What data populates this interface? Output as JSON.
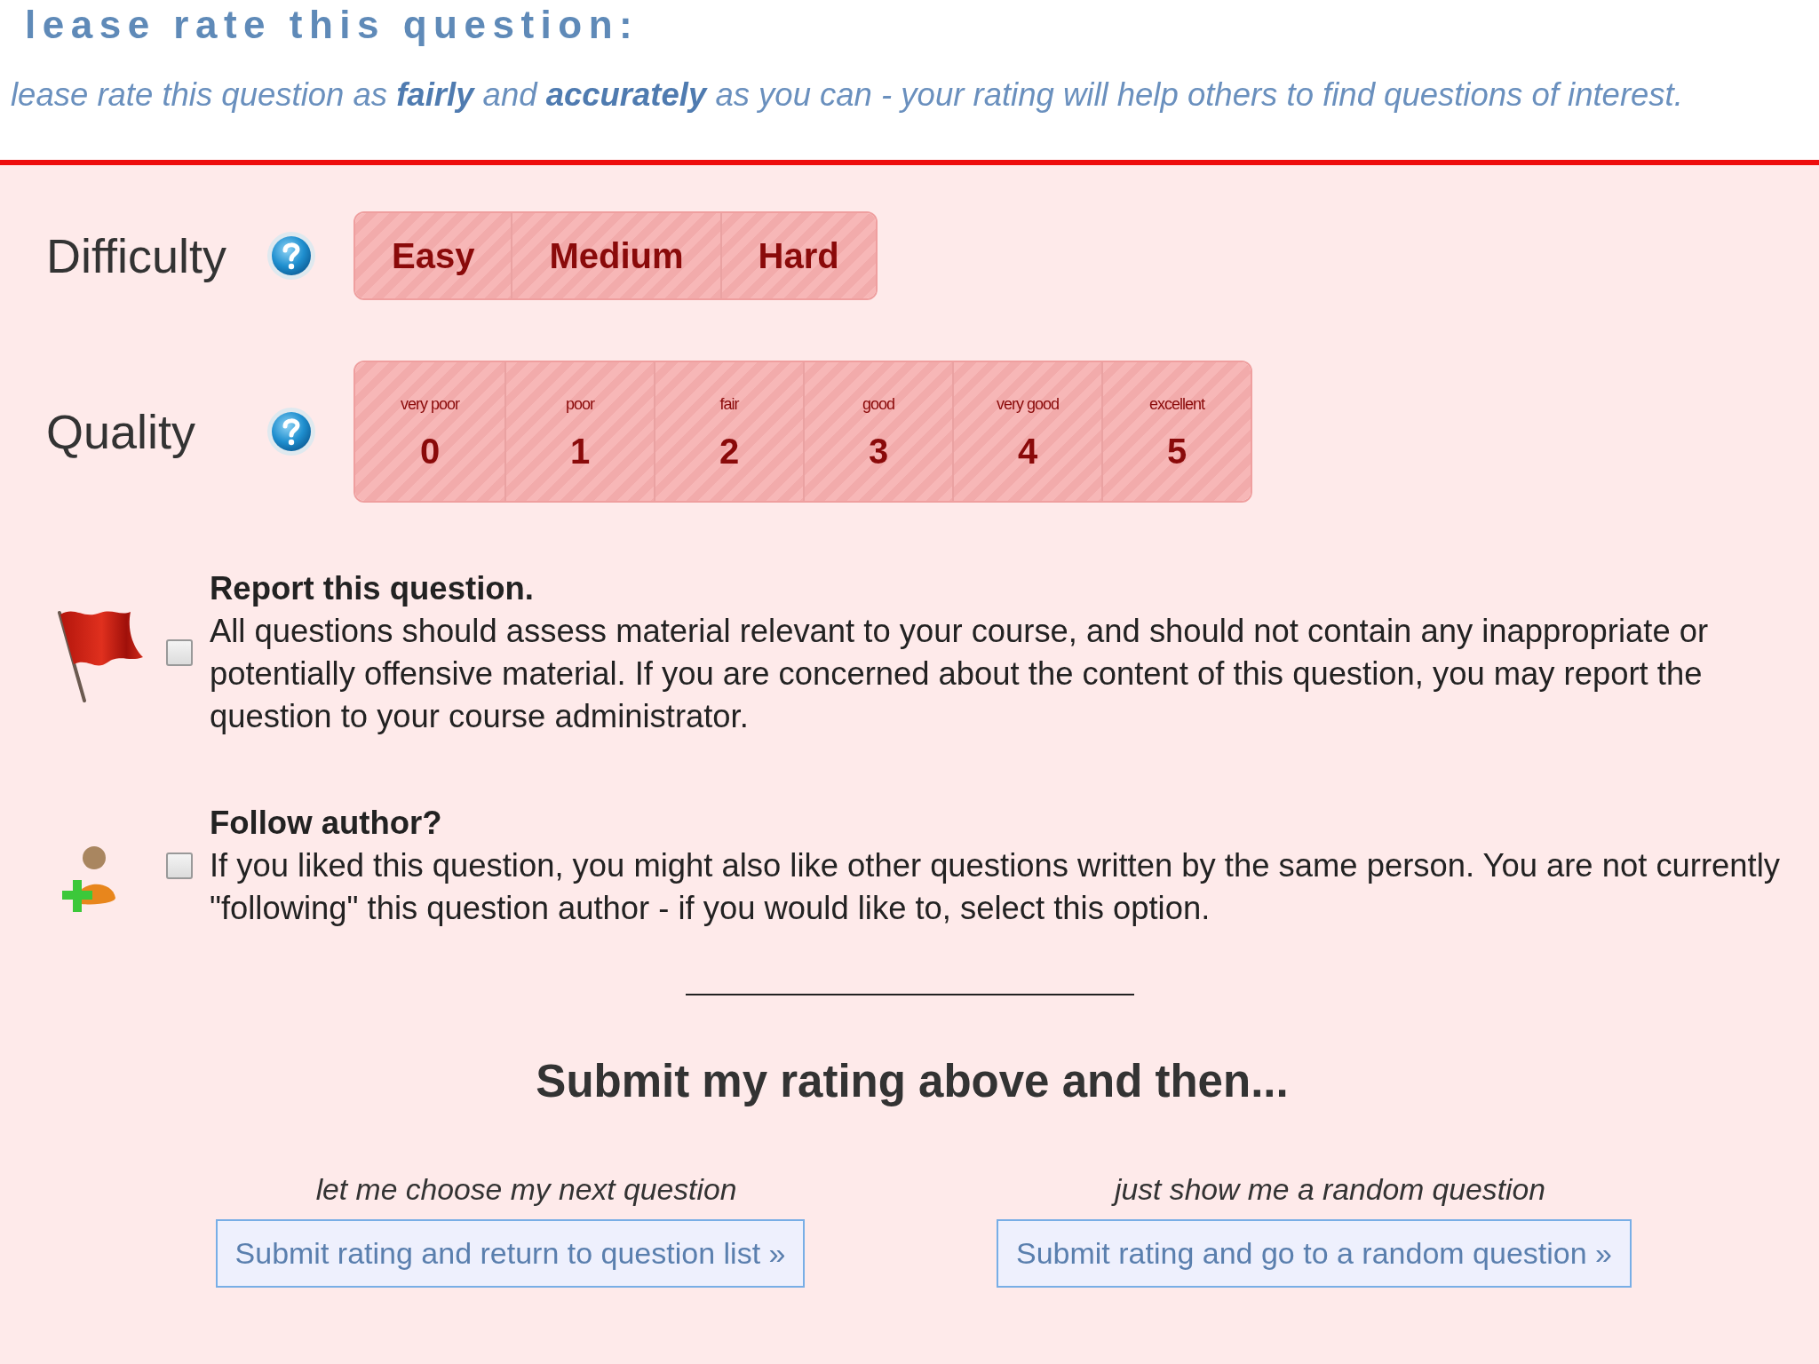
{
  "header": {
    "title": "lease rate this question:",
    "intro": "lease rate this question as **fairly** and **accurately** as you can - your rating will help others to find questions of interest."
  },
  "ratings": [
    {
      "label": "Difficulty",
      "options": [
        {
          "label": "Easy",
          "selected": false
        },
        {
          "label": "Medium",
          "selected": false
        },
        {
          "label": "Hard",
          "selected": false
        }
      ]
    },
    {
      "label": "Quality",
      "options": [
        {
          "caption": "very poor",
          "label": "0",
          "selected": false
        },
        {
          "caption": "poor",
          "label": "1",
          "selected": false
        },
        {
          "caption": "fair",
          "label": "2",
          "selected": false
        },
        {
          "caption": "good",
          "label": "3",
          "selected": false
        },
        {
          "caption": "very good",
          "label": "4",
          "selected": false
        },
        {
          "caption": "excellent",
          "label": "5",
          "selected": false
        }
      ]
    }
  ],
  "options": [
    {
      "kind": "report",
      "title": "Report this question.",
      "text": "All questions should assess material relevant to your course, and should not contain any inappropriate or potentially offensive material. If you are concerned about the content of this question, you may report the question to your course administrator.",
      "checked": false
    },
    {
      "kind": "follow",
      "title": "Follow author?",
      "text": "If you liked this question, you might also like other questions written by the same person. You are not currently \"following\" this question author - if you would like to, select this option.",
      "checked": false
    }
  ],
  "submit": {
    "heading": "Submit my rating above and then...",
    "choices": [
      {
        "caption": "let me choose my next question",
        "button": "Submit rating and return to question list »"
      },
      {
        "caption": "just show me a random question",
        "button": "Submit rating and go to a random question »"
      }
    ]
  }
}
